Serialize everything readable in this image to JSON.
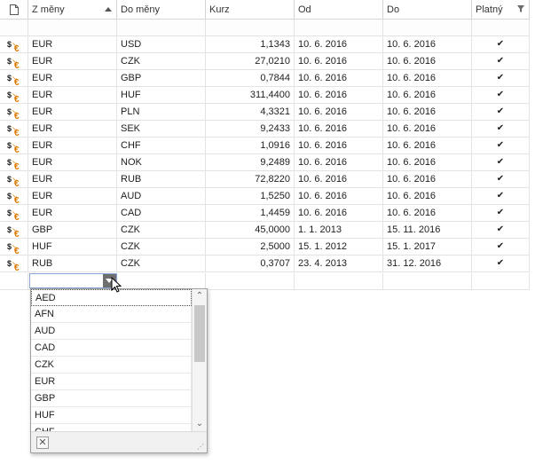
{
  "columns": {
    "icon": "",
    "from": "Z měny",
    "to": "Do měny",
    "rate": "Kurz",
    "valid_from": "Od",
    "valid_to": "Do",
    "valid": "Platný"
  },
  "rows": [
    {
      "from": "EUR",
      "to": "USD",
      "rate": "1,1343",
      "valid_from": "10. 6. 2016",
      "valid_to": "10. 6. 2016",
      "valid": "✔"
    },
    {
      "from": "EUR",
      "to": "CZK",
      "rate": "27,0210",
      "valid_from": "10. 6. 2016",
      "valid_to": "10. 6. 2016",
      "valid": "✔"
    },
    {
      "from": "EUR",
      "to": "GBP",
      "rate": "0,7844",
      "valid_from": "10. 6. 2016",
      "valid_to": "10. 6. 2016",
      "valid": "✔"
    },
    {
      "from": "EUR",
      "to": "HUF",
      "rate": "311,4400",
      "valid_from": "10. 6. 2016",
      "valid_to": "10. 6. 2016",
      "valid": "✔"
    },
    {
      "from": "EUR",
      "to": "PLN",
      "rate": "4,3321",
      "valid_from": "10. 6. 2016",
      "valid_to": "10. 6. 2016",
      "valid": "✔"
    },
    {
      "from": "EUR",
      "to": "SEK",
      "rate": "9,2433",
      "valid_from": "10. 6. 2016",
      "valid_to": "10. 6. 2016",
      "valid": "✔"
    },
    {
      "from": "EUR",
      "to": "CHF",
      "rate": "1,0916",
      "valid_from": "10. 6. 2016",
      "valid_to": "10. 6. 2016",
      "valid": "✔"
    },
    {
      "from": "EUR",
      "to": "NOK",
      "rate": "9,2489",
      "valid_from": "10. 6. 2016",
      "valid_to": "10. 6. 2016",
      "valid": "✔"
    },
    {
      "from": "EUR",
      "to": "RUB",
      "rate": "72,8220",
      "valid_from": "10. 6. 2016",
      "valid_to": "10. 6. 2016",
      "valid": "✔"
    },
    {
      "from": "EUR",
      "to": "AUD",
      "rate": "1,5250",
      "valid_from": "10. 6. 2016",
      "valid_to": "10. 6. 2016",
      "valid": "✔"
    },
    {
      "from": "EUR",
      "to": "CAD",
      "rate": "1,4459",
      "valid_from": "10. 6. 2016",
      "valid_to": "10. 6. 2016",
      "valid": "✔"
    },
    {
      "from": "GBP",
      "to": "CZK",
      "rate": "45,0000",
      "valid_from": "1. 1. 2013",
      "valid_to": "15. 11. 2016",
      "valid": "✔"
    },
    {
      "from": "HUF",
      "to": "CZK",
      "rate": "2,5000",
      "valid_from": "15. 1. 2012",
      "valid_to": "15. 1. 2017",
      "valid": "✔"
    },
    {
      "from": "RUB",
      "to": "CZK",
      "rate": "0,3707",
      "valid_from": "23. 4. 2013",
      "valid_to": "31. 12. 2016",
      "valid": "✔"
    }
  ],
  "row_icon": "exchange-rate-icon",
  "new_row": {
    "from": "",
    "to": "",
    "rate": "",
    "valid_from": "",
    "valid_to": ""
  },
  "dropdown": {
    "items": [
      "AED",
      "AFN",
      "AUD",
      "CAD",
      "CZK",
      "EUR",
      "GBP",
      "HUF",
      "CHF"
    ],
    "selected": "AED",
    "clear_label": "✕"
  },
  "colors": {
    "accent_orange": "#e07a00",
    "grid_line": "#e3e3e3",
    "focus_border": "#8aa6d6"
  }
}
